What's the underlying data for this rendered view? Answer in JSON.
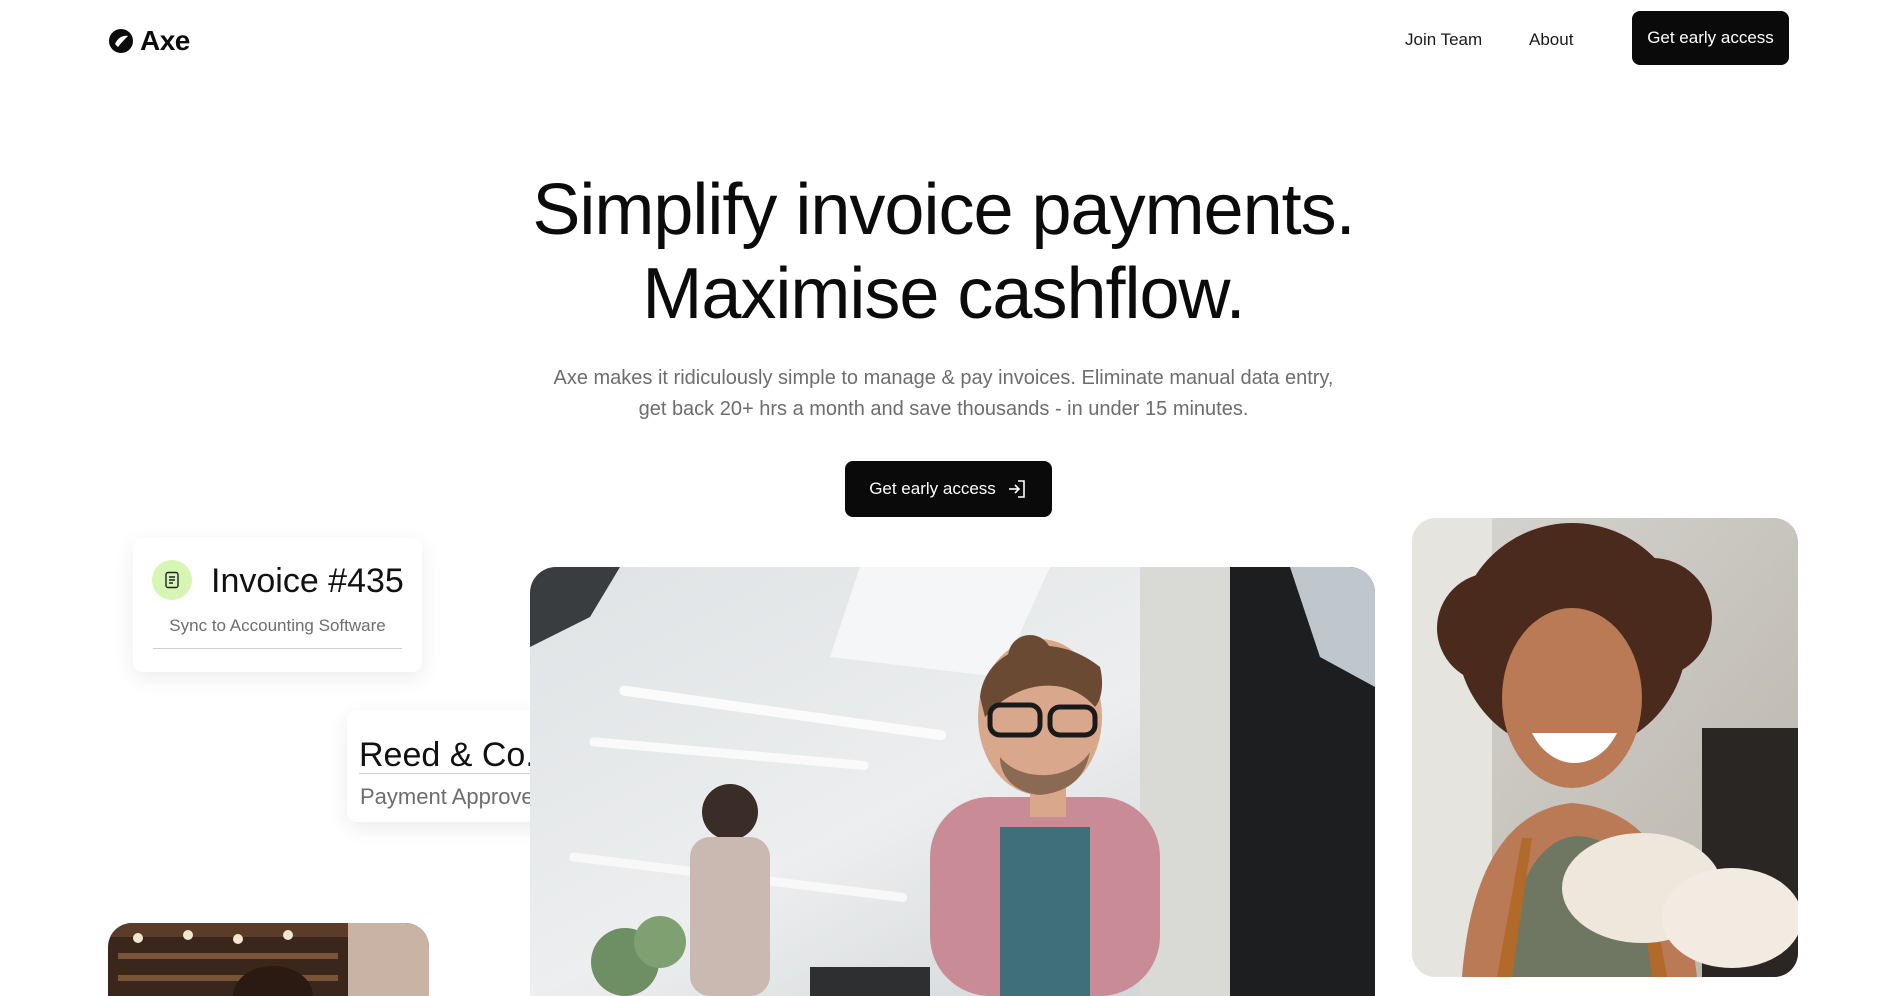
{
  "header": {
    "logo_text": "Axe",
    "logo_icon": "axe-logo-icon",
    "nav": [
      {
        "label": "Join Team"
      },
      {
        "label": "About"
      }
    ],
    "cta_label": "Get early access"
  },
  "hero": {
    "title_line1": "Simplify invoice payments.",
    "title_line2": "Maximise cashflow.",
    "subtitle_line1": "Axe makes it ridiculously simple to manage & pay invoices. Eliminate manual data entry,",
    "subtitle_line2": "get back 20+ hrs a month and save thousands - in under 15 minutes.",
    "cta_label": "Get early access",
    "cta_icon": "enter-icon"
  },
  "invoice_card": {
    "title": "Invoice #435",
    "subtitle": "Sync to Accounting Software",
    "icon": "document-icon"
  },
  "payment_card": {
    "title": "Reed & Co.",
    "status": "Payment Approved.",
    "icons": [
      "arrow-right-icon",
      "check-icon"
    ]
  },
  "photos": [
    {
      "name": "man-with-laptop-photo"
    },
    {
      "name": "smiling-woman-photo"
    },
    {
      "name": "cafe-woman-photo"
    }
  ],
  "colors": {
    "primary": "#0a0a0a",
    "accent_green": "#d7f5b3",
    "muted_text": "#6d6d6d"
  }
}
